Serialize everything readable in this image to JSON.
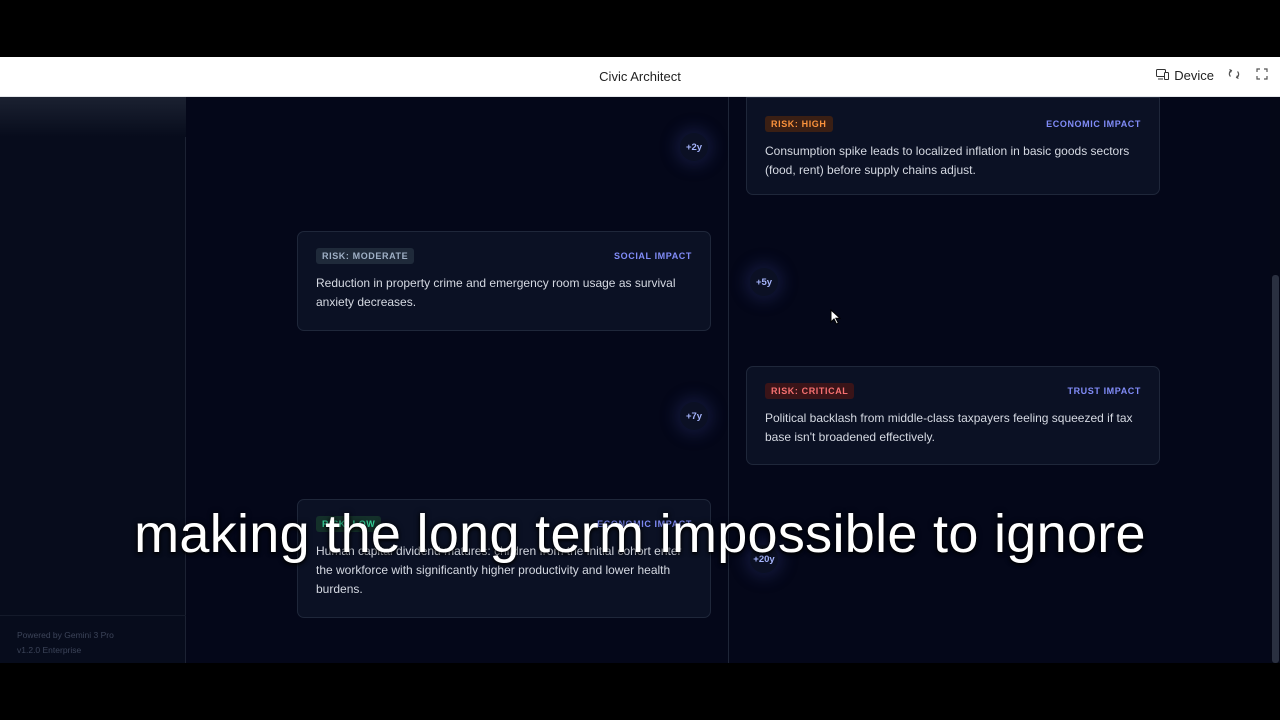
{
  "window": {
    "title": "Civic Architect",
    "device_label": "Device",
    "device_icon": "device-icon",
    "refresh_icon": "refresh-icon",
    "fullscreen_icon": "fullscreen-icon"
  },
  "sidebar": {
    "powered_by": "Powered by Gemini 3 Pro",
    "version": "v1.2.0 Enterprise"
  },
  "timeline": {
    "markers": [
      "+2y",
      "+5y",
      "+7y",
      "+20y"
    ],
    "cards": [
      {
        "risk": "RISK: HIGH",
        "impact": "ECONOMIC IMPACT",
        "text": "Consumption spike leads to localized inflation in basic goods sectors (food, rent) before supply chains adjust."
      },
      {
        "risk": "RISK: MODERATE",
        "impact": "SOCIAL IMPACT",
        "text": "Reduction in property crime and emergency room usage as survival anxiety decreases."
      },
      {
        "risk": "RISK: CRITICAL",
        "impact": "TRUST IMPACT",
        "text": "Political backlash from middle-class taxpayers feeling squeezed if tax base isn't broadened effectively."
      },
      {
        "risk": "RISK: LOW",
        "impact": "ECONOMIC IMPACT",
        "text": "Human capital dividend matures: children from the initial cohort enter the workforce with significantly higher productivity and lower health burdens."
      }
    ]
  },
  "caption": "making the long term impossible to ignore",
  "colors": {
    "background": "#040719",
    "card": "#0b1124",
    "accent": "#818cf8",
    "risk_high": "#fb923c",
    "risk_critical": "#f87171",
    "risk_moderate": "#9fb0c6"
  }
}
